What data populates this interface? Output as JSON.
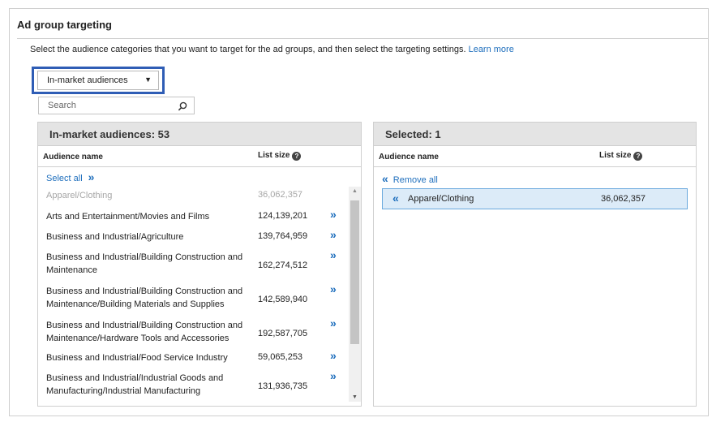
{
  "section": {
    "title": "Ad group targeting",
    "intro": "Select the audience categories that you want to target for the ad groups, and then select the targeting settings.",
    "learn_more": "Learn more"
  },
  "category_select": {
    "value": "In-market audiences",
    "caret": "▼"
  },
  "search": {
    "placeholder": "Search"
  },
  "available": {
    "title": "In-market audiences: 53",
    "col_name": "Audience name",
    "col_size": "List size",
    "select_all": "Select all",
    "rows": [
      {
        "name": "Apparel/Clothing",
        "size": "36,062,357",
        "disabled": true
      },
      {
        "name": "Arts and Entertainment/Movies and Films",
        "size": "124,139,201",
        "disabled": false
      },
      {
        "name": "Business and Industrial/Agriculture",
        "size": "139,764,959",
        "disabled": false
      },
      {
        "name": "Business and Industrial/Building Construction and Maintenance",
        "size": "162,274,512",
        "disabled": false
      },
      {
        "name": "Business and Industrial/Building Construction and Maintenance/Building Materials and Supplies",
        "size": "142,589,940",
        "disabled": false
      },
      {
        "name": "Business and Industrial/Building Construction and Maintenance/Hardware Tools and Accessories",
        "size": "192,587,705",
        "disabled": false
      },
      {
        "name": "Business and Industrial/Food Service Industry",
        "size": "59,065,253",
        "disabled": false
      },
      {
        "name": "Business and Industrial/Industrial Goods and Manufacturing/Industrial Manufacturing",
        "size": "131,936,735",
        "disabled": false
      }
    ]
  },
  "selected": {
    "title": "Selected: 1",
    "col_name": "Audience name",
    "col_size": "List size",
    "remove_all": "Remove all",
    "rows": [
      {
        "name": "Apparel/Clothing",
        "size": "36,062,357"
      }
    ]
  },
  "glyphs": {
    "add": "»",
    "remove": "«",
    "info": "?",
    "scroll_up": "▲",
    "scroll_down": "▼"
  },
  "colors": {
    "link": "#1f6fbd",
    "highlight_border": "#2f5db5",
    "selected_row_bg": "#dcebf8",
    "panel_header_bg": "#e4e4e4"
  }
}
